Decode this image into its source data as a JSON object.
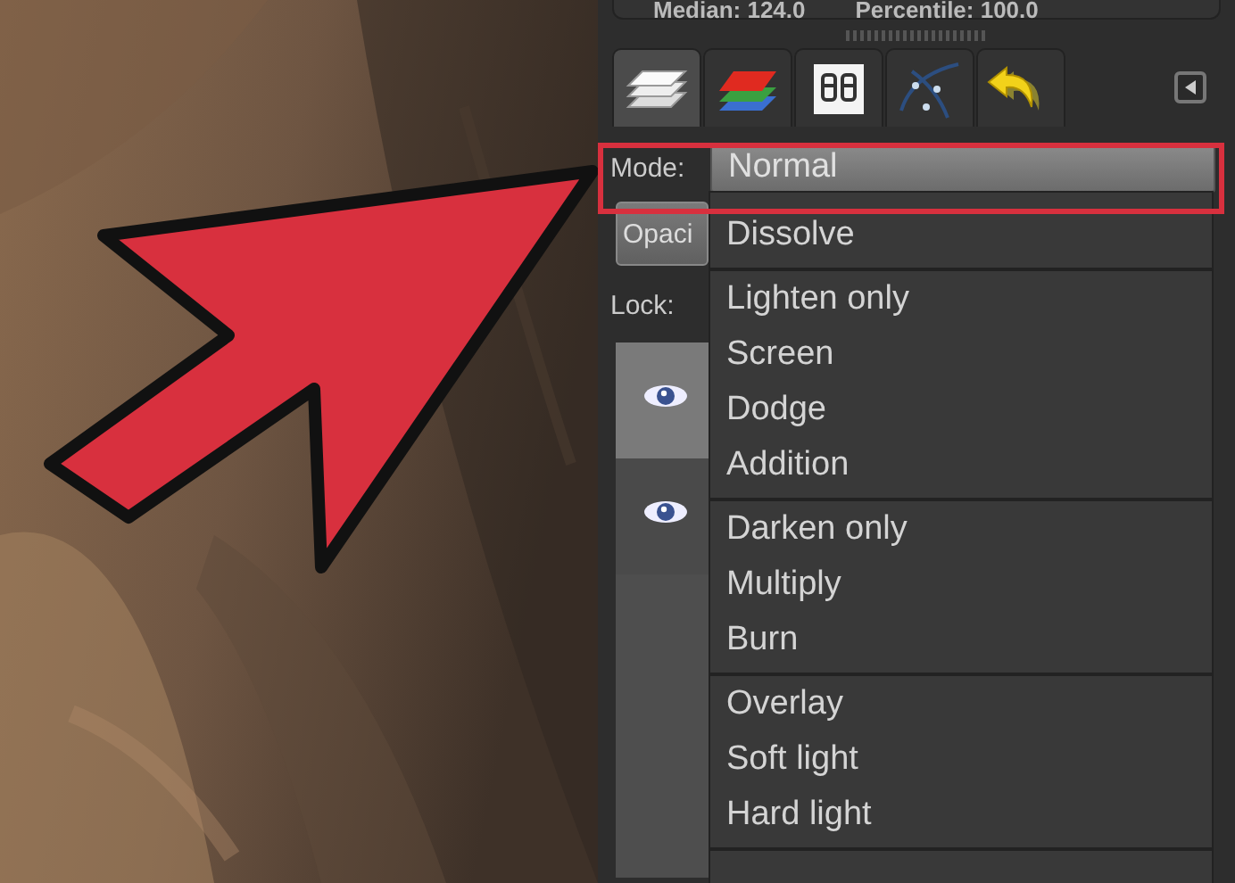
{
  "stats": [
    {
      "label": "Median:",
      "value": "124.0"
    },
    {
      "label": "Percentile:",
      "value": "100.0"
    }
  ],
  "tabs": [
    {
      "kind": "layers",
      "selected": true
    },
    {
      "kind": "channels",
      "selected": false
    },
    {
      "kind": "device",
      "selected": false
    },
    {
      "kind": "paths",
      "selected": false
    },
    {
      "kind": "undo",
      "selected": false
    }
  ],
  "mode": {
    "label": "Mode:",
    "value": "Normal"
  },
  "opacity_label": "Opaci",
  "lock_label": "Lock:",
  "layers": [
    {
      "visible": true,
      "selected": true
    },
    {
      "visible": true,
      "selected": false
    }
  ],
  "mode_menu": {
    "groups": [
      [
        "Dissolve"
      ],
      [
        "Lighten only",
        "Screen",
        "Dodge",
        "Addition"
      ],
      [
        "Darken only",
        "Multiply",
        "Burn"
      ],
      [
        "Overlay",
        "Soft light",
        "Hard light"
      ]
    ]
  },
  "annotation": {
    "arrow": true,
    "highlight": true
  }
}
